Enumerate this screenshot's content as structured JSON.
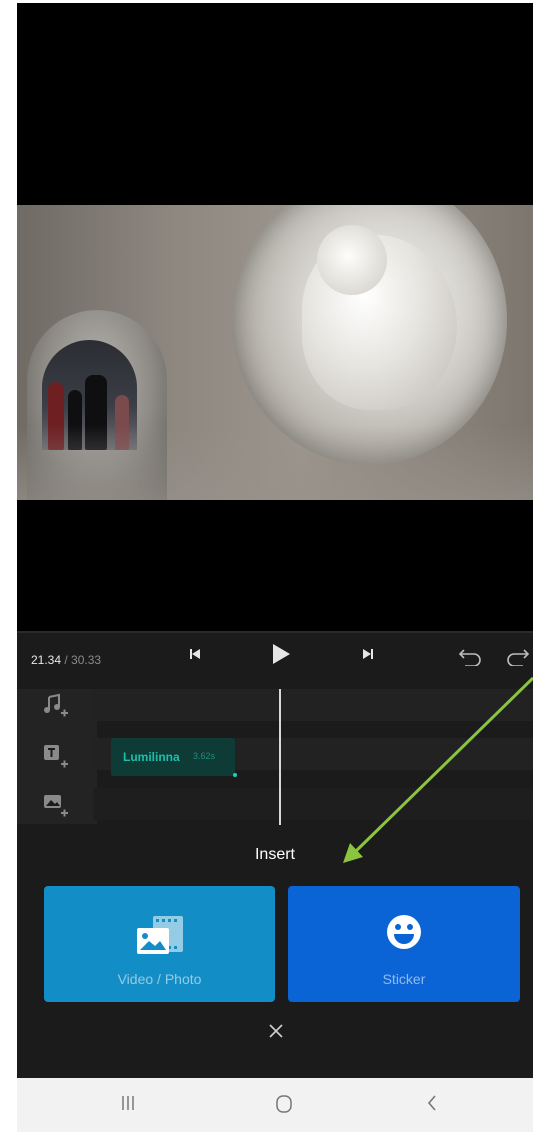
{
  "player": {
    "current_time": "21.34",
    "separator_total": "/ 30.33"
  },
  "timeline": {
    "text_clip": {
      "label": "Lumilinna",
      "duration": "3.62s"
    }
  },
  "insert_sheet": {
    "title": "Insert",
    "options": [
      {
        "label": "Video / Photo",
        "icon": "video-photo-icon",
        "color": "#138dc6"
      },
      {
        "label": "Sticker",
        "icon": "smiley-icon",
        "color": "#0b64d6"
      }
    ],
    "close_icon": "close-icon"
  },
  "colors": {
    "accent_teal": "#1dbfa9",
    "annotation_arrow": "#8bc53f"
  }
}
